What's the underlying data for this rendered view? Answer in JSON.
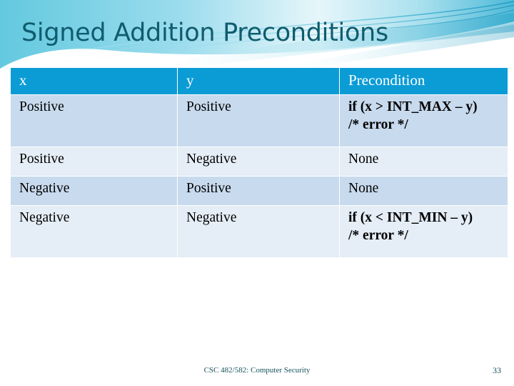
{
  "slide": {
    "title": "Signed Addition Preconditions",
    "footer": "CSC 482/582: Computer Security",
    "number": "33"
  },
  "theme": {
    "title_color": "#0f5c6e",
    "header_fill": "#0b9cd6",
    "row_dark": "#c8daed",
    "row_light": "#e5edf6",
    "banner_cyan": "#6ccbe0",
    "banner_teal": "#2aa9c9",
    "footer_color": "#17525e"
  },
  "table": {
    "headers": [
      "x",
      "y",
      "Precondition"
    ],
    "rows": [
      {
        "x": "Positive",
        "y": "Positive",
        "precondition_line1": "if (x > INT_MAX – y)",
        "precondition_line2": "/* error */"
      },
      {
        "x": "Positive",
        "y": "Negative",
        "precondition_line1": "None",
        "precondition_line2": ""
      },
      {
        "x": "Negative",
        "y": "Positive",
        "precondition_line1": "None",
        "precondition_line2": ""
      },
      {
        "x": "Negative",
        "y": "Negative",
        "precondition_line1": "if (x < INT_MIN – y)",
        "precondition_line2": "/* error */"
      }
    ]
  }
}
